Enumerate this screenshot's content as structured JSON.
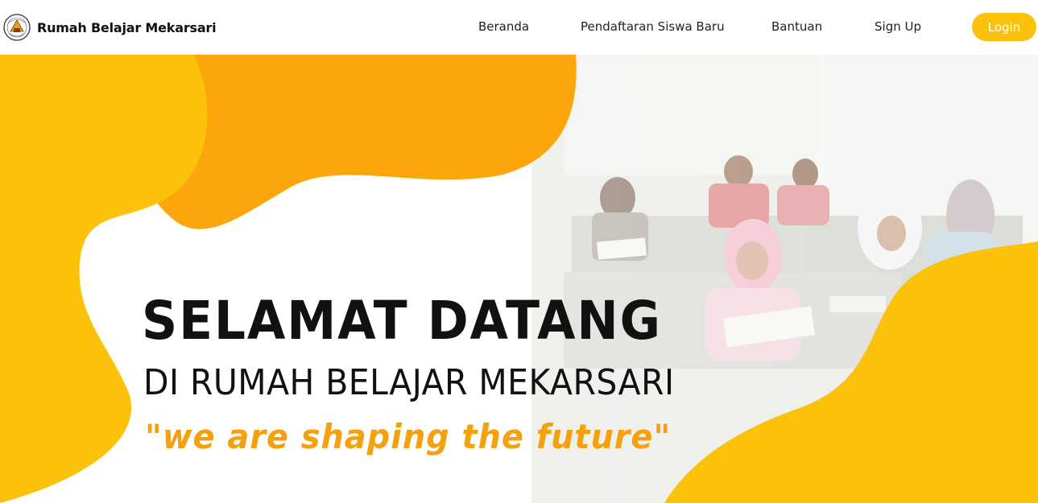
{
  "colors": {
    "accent": "#FCC20B",
    "accent_dark": "#FCA60B",
    "tagline": "#F5A10E",
    "login_bg": "#FCC20B"
  },
  "navbar": {
    "brand_name": "Rumah Belajar Mekarsari",
    "logo_icon": "school-emblem-logo",
    "links": [
      "Beranda",
      "Pendaftaran Siswa Baru",
      "Bantuan",
      "Sign Up"
    ],
    "login_label": "Login"
  },
  "hero": {
    "headline": "SELAMAT DATANG",
    "subheadline": "DI RUMAH BELAJAR MEKARSARI",
    "tagline": "\"we are shaping the future\"",
    "background_image": "classroom-students-photo"
  }
}
